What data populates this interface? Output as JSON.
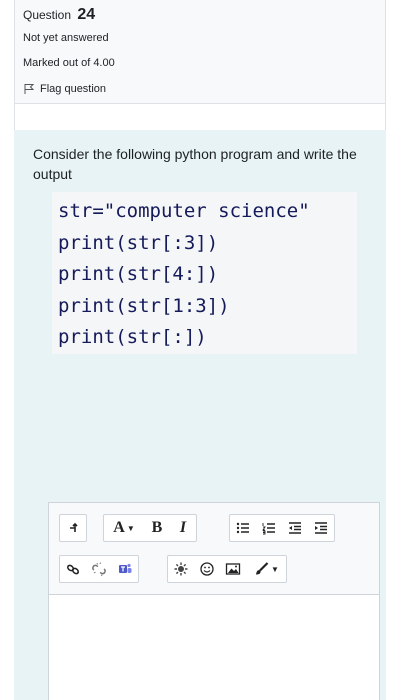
{
  "question": {
    "label": "Question",
    "number": "24",
    "status": "Not yet answered",
    "marks": "Marked out of 4.00",
    "flag_label": "Flag question"
  },
  "question_text": "Consider the following python program and write the output",
  "code_lines": [
    "str=\"computer science\"",
    "print(str[:3])",
    "print(str[4:])",
    "print(str[1:3])",
    "print(str[:])"
  ],
  "editor": {
    "font_button_label": "A",
    "bold_label": "B",
    "italic_label": "I"
  },
  "colors": {
    "info_bg": "#f8f9fa",
    "content_bg": "#e7f3f5",
    "code_bg": "#f5f6f7",
    "code_text": "#151a5a"
  }
}
